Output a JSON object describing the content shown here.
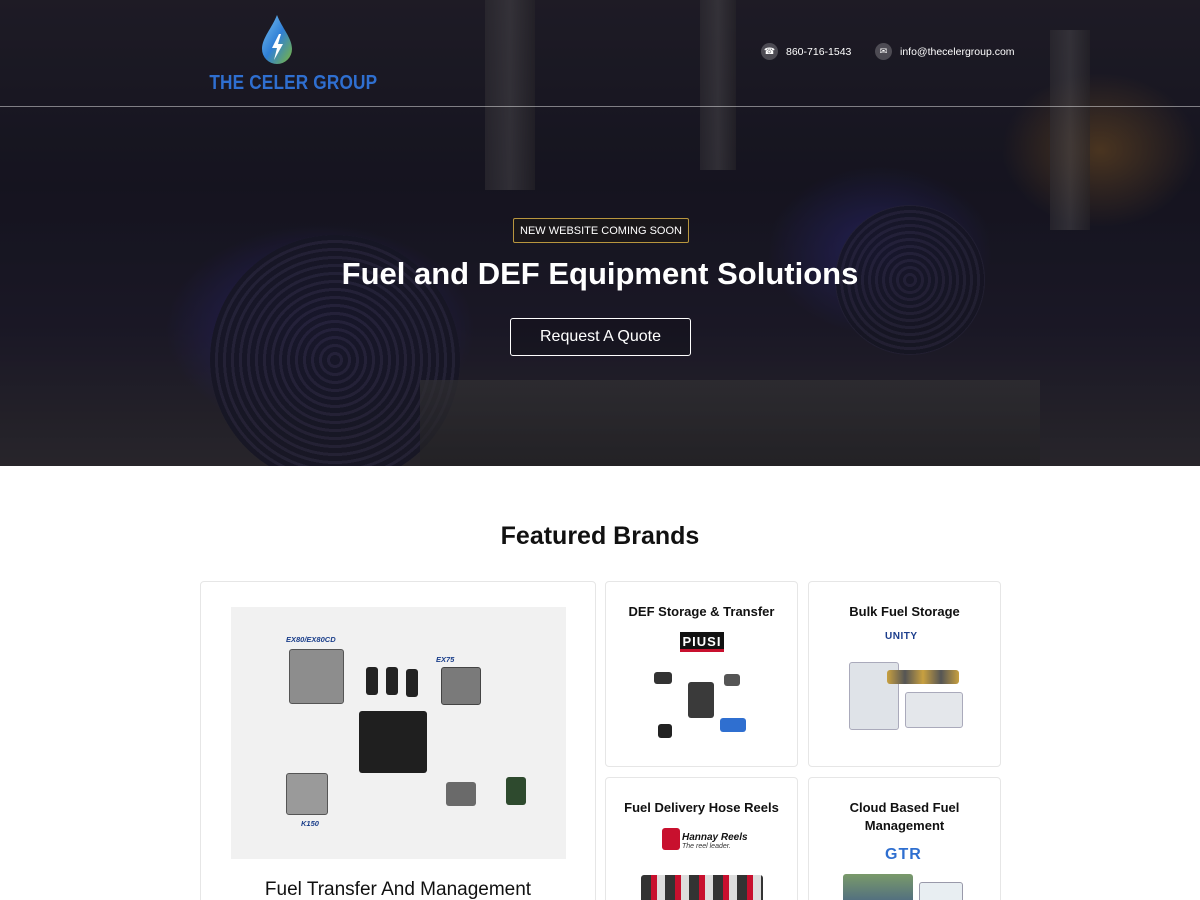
{
  "header": {
    "logo_text": "THE CELER GROUP",
    "phone": "860-716-1543",
    "email": "info@thecelergroup.com"
  },
  "hero": {
    "badge": "NEW WEBSITE COMING SOON",
    "title": "Fuel and DEF Equipment Solutions",
    "cta_label": "Request A Quote"
  },
  "featured": {
    "title": "Featured Brands",
    "big_card": {
      "title": "Fuel Transfer And Management",
      "labels": [
        "EX80/EX80CD",
        "EX75",
        "K150"
      ]
    },
    "cards": [
      {
        "title": "DEF Storage & Transfer",
        "brand": "PIUSI"
      },
      {
        "title": "Bulk Fuel Storage",
        "brand": "UNITY"
      },
      {
        "title": "Fuel Delivery Hose Reels",
        "brand": "Hannay Reels",
        "tagline": "The reel leader."
      },
      {
        "title": "Cloud Based Fuel Management",
        "brand": "GTR"
      }
    ]
  },
  "colors": {
    "logo_blue": "#2f6fd0",
    "badge_border": "#b8963e",
    "hannay_red": "#c8102e"
  },
  "icons": [
    "phone-icon",
    "email-icon",
    "logo-drop-icon"
  ]
}
